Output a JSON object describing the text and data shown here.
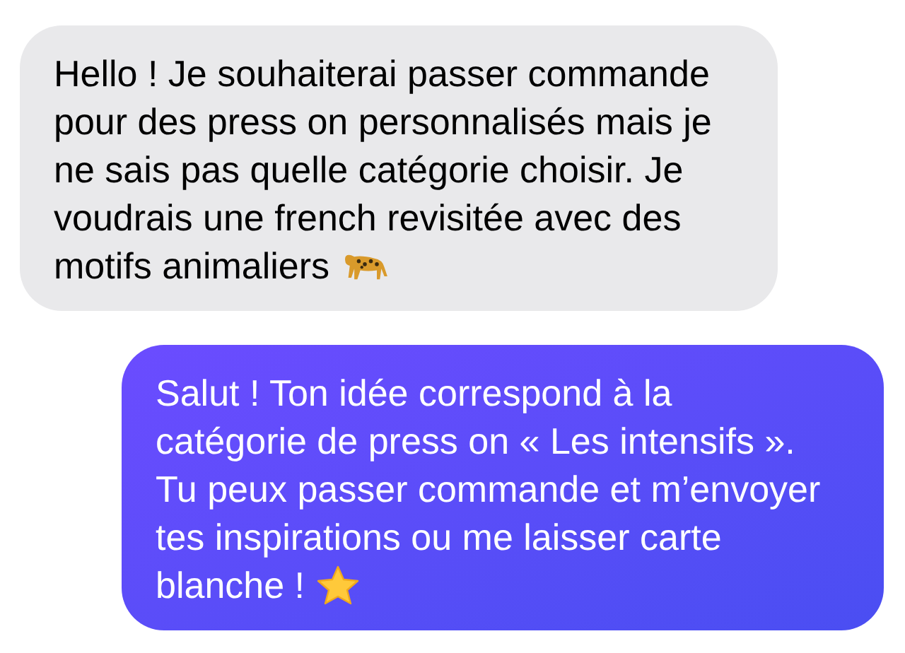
{
  "messages": [
    {
      "kind": "incoming",
      "lines": [
        "Hello ! Je souhaiterai passer commande",
        "pour des press on personnalisés mais je",
        "ne sais pas quelle catégorie choisir. Je",
        "voudrais une french revisitée avec des",
        "motifs animaliers"
      ]
    },
    {
      "kind": "outgoing",
      "lines": [
        "Salut ! Ton idée correspond à la",
        "catégorie de press on « Les intensifs ».",
        "Tu peux passer commande et m’envoyer",
        "tes inspirations ou me laisser carte",
        "blanche !"
      ]
    }
  ]
}
